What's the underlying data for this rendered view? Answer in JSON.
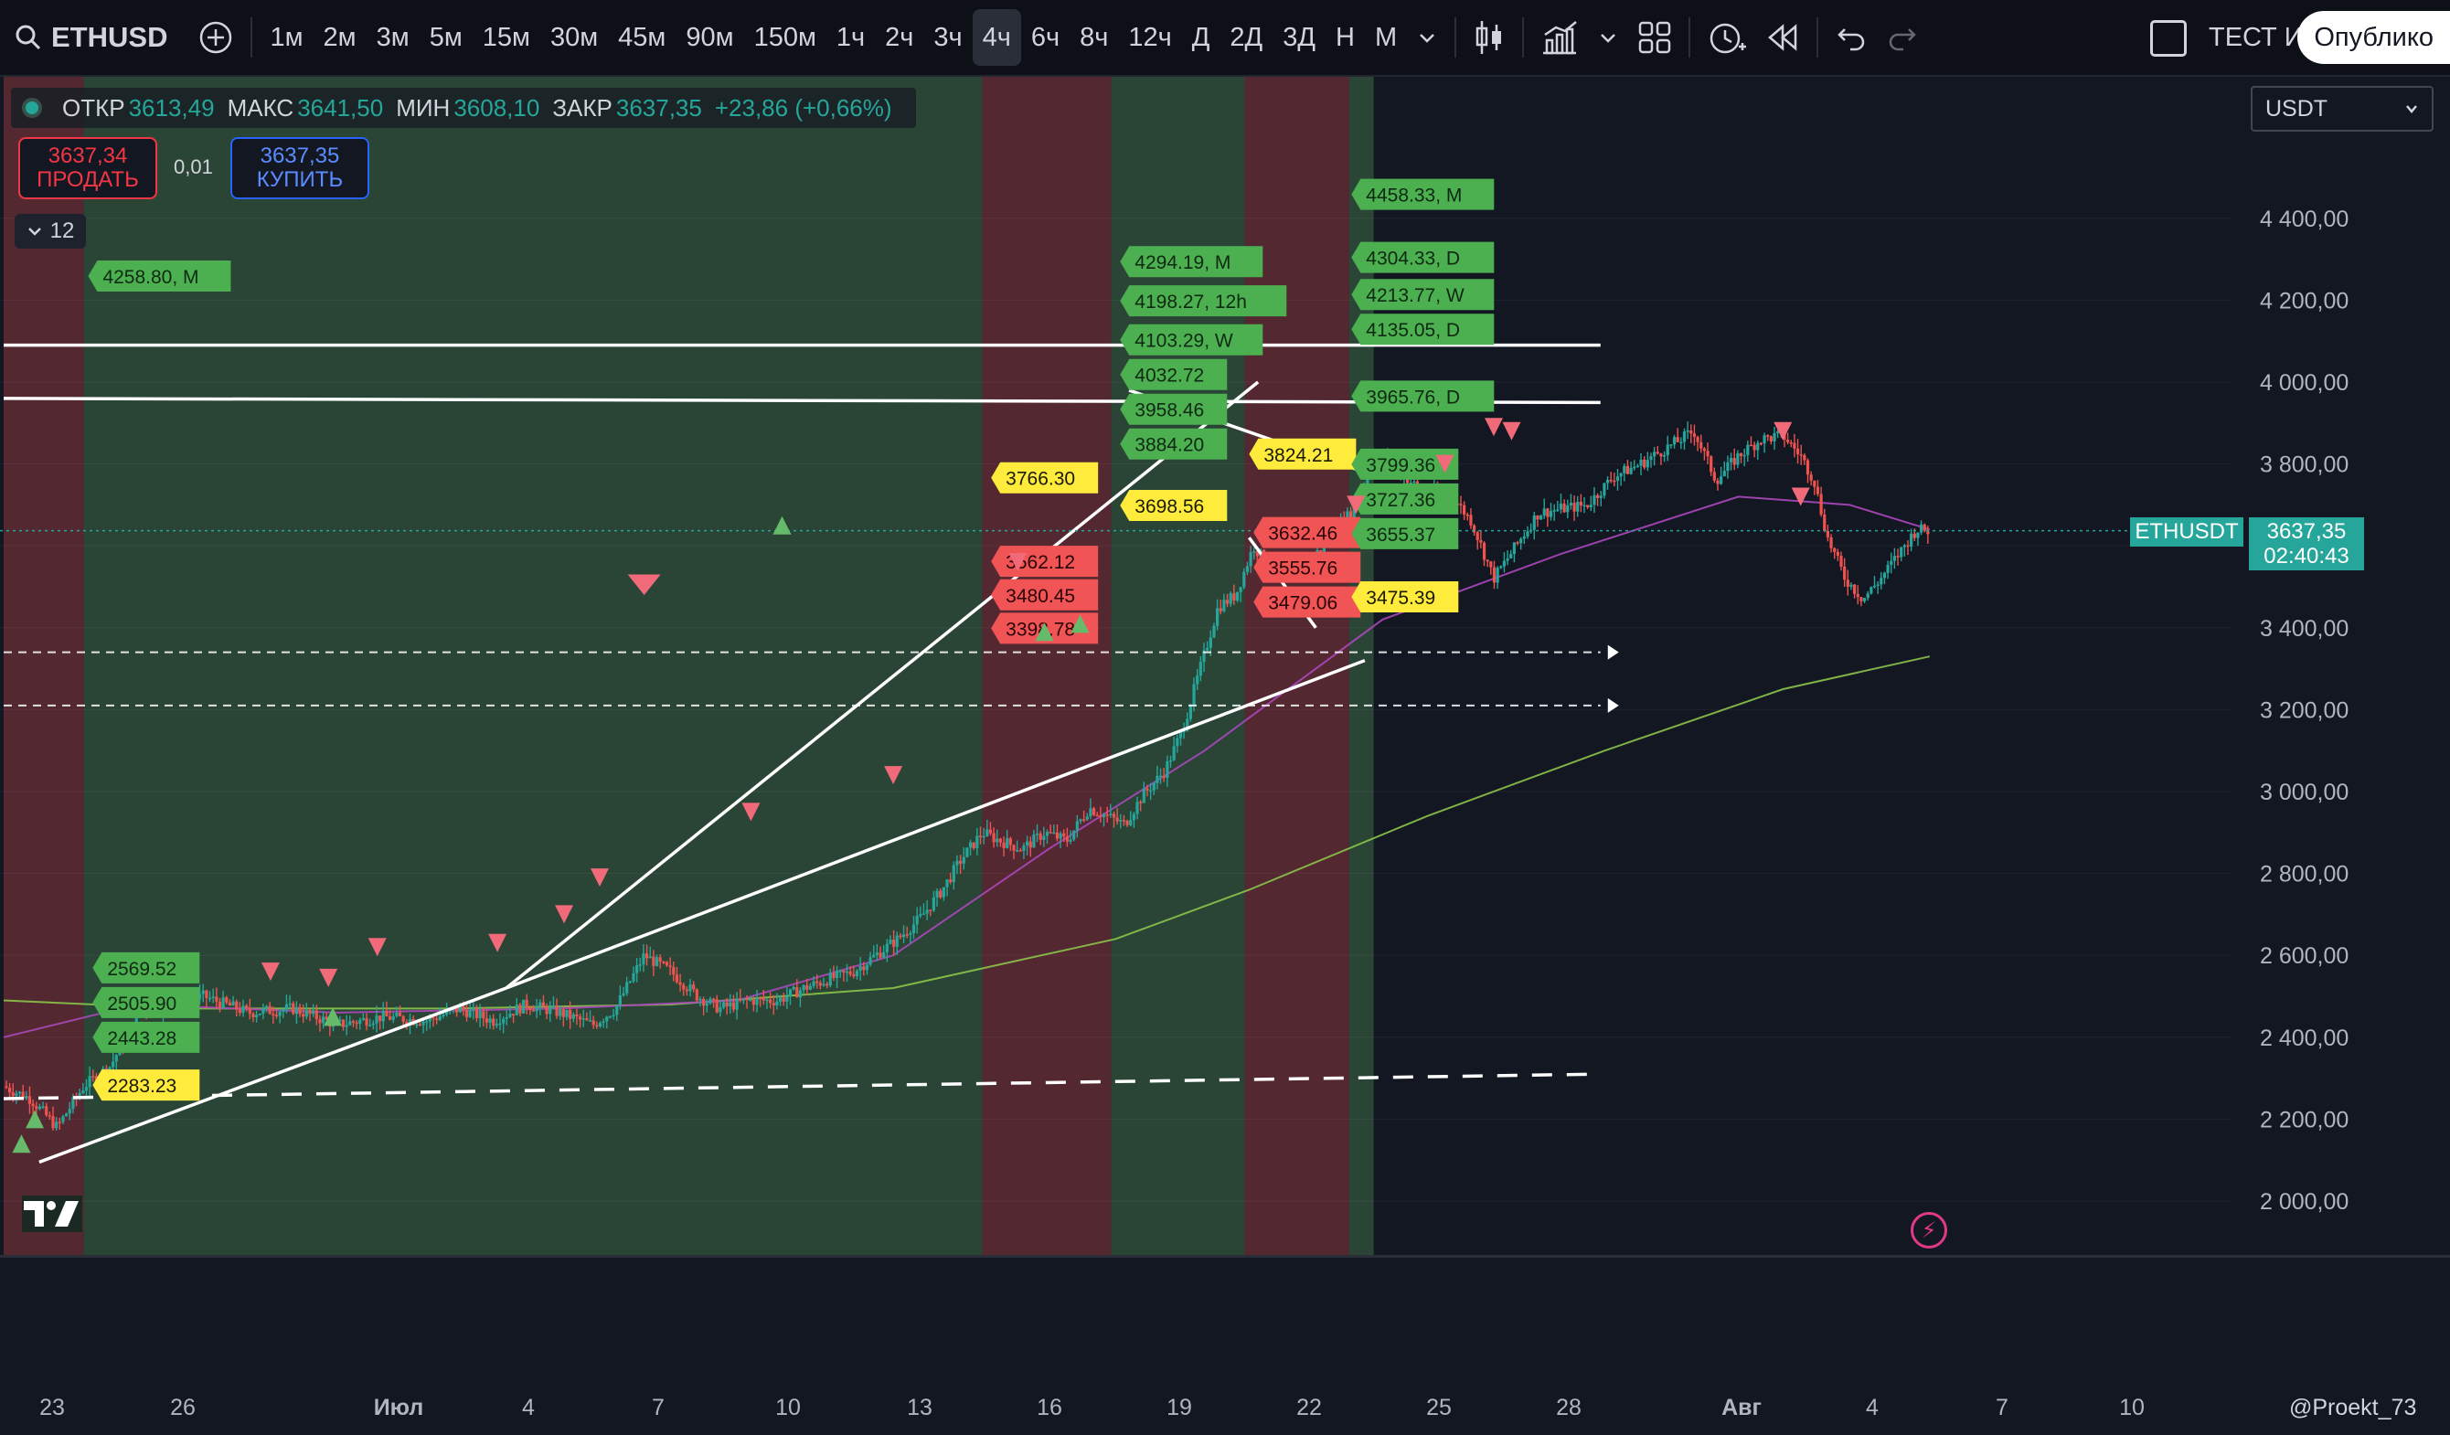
{
  "toolbar": {
    "symbol": "ETHUSD",
    "intervals": [
      "1м",
      "2м",
      "3м",
      "5м",
      "15м",
      "30м",
      "45м",
      "90м",
      "150м",
      "1ч",
      "2ч",
      "3ч",
      "4ч",
      "6ч",
      "8ч",
      "12ч",
      "Д",
      "2Д",
      "3Д",
      "Н",
      "М"
    ],
    "active_interval": "4ч",
    "test_label": "ТЕСТ И",
    "publish_label": "Опублико"
  },
  "legend": {
    "open_label": "ОТКР",
    "open": "3613,49",
    "high_label": "МАКС",
    "high": "3641,50",
    "low_label": "МИН",
    "low": "3608,10",
    "close_label": "ЗАКР",
    "close": "3637,35",
    "change": "+23,86 (+0,66%)"
  },
  "trade": {
    "sell_price": "3637,34",
    "sell_label": "ПРОДАТЬ",
    "spread": "0,01",
    "buy_price": "3637,35",
    "buy_label": "КУПИТЬ",
    "indicators_count": "12"
  },
  "currency": "USDT",
  "price_tag": {
    "name": "ETHUSDT",
    "price": "3637,35",
    "countdown": "02:40:43"
  },
  "watermark": "@Proekt_73",
  "colors": {
    "up": "#26a69a",
    "down": "#ef5350",
    "bg": "#131722"
  },
  "chart_data": {
    "type": "candlestick",
    "symbol": "ETHUSDT",
    "interval": "4h",
    "ylim": [
      1900,
      4600
    ],
    "y_ticks": [
      "2 000,00",
      "2 200,00",
      "2 400,00",
      "2 600,00",
      "2 800,00",
      "3 000,00",
      "3 200,00",
      "3 400,00",
      "3 600,00",
      "3 800,00",
      "4 000,00",
      "4 200,00",
      "4 400,00"
    ],
    "x_ticks": [
      "23",
      "26",
      "Июл",
      "4",
      "7",
      "10",
      "13",
      "16",
      "19",
      "22",
      "25",
      "28",
      "Авг",
      "4",
      "7",
      "10"
    ],
    "close_path": [
      [
        0,
        2280
      ],
      [
        12,
        2250
      ],
      [
        24,
        2180
      ],
      [
        36,
        2280
      ],
      [
        48,
        2330
      ],
      [
        62,
        2470
      ],
      [
        76,
        2480
      ],
      [
        90,
        2500
      ],
      [
        110,
        2460
      ],
      [
        130,
        2470
      ],
      [
        150,
        2430
      ],
      [
        170,
        2450
      ],
      [
        190,
        2440
      ],
      [
        205,
        2470
      ],
      [
        220,
        2440
      ],
      [
        235,
        2480
      ],
      [
        250,
        2460
      ],
      [
        265,
        2430
      ],
      [
        275,
        2470
      ],
      [
        288,
        2600
      ],
      [
        300,
        2560
      ],
      [
        312,
        2500
      ],
      [
        322,
        2470
      ],
      [
        335,
        2490
      ],
      [
        348,
        2490
      ],
      [
        360,
        2520
      ],
      [
        370,
        2540
      ],
      [
        382,
        2560
      ],
      [
        392,
        2600
      ],
      [
        402,
        2640
      ],
      [
        412,
        2690
      ],
      [
        422,
        2760
      ],
      [
        430,
        2830
      ],
      [
        440,
        2900
      ],
      [
        448,
        2880
      ],
      [
        458,
        2860
      ],
      [
        468,
        2900
      ],
      [
        478,
        2880
      ],
      [
        488,
        2960
      ],
      [
        496,
        2940
      ],
      [
        504,
        2920
      ],
      [
        512,
        2990
      ],
      [
        522,
        3050
      ],
      [
        530,
        3150
      ],
      [
        538,
        3300
      ],
      [
        546,
        3450
      ],
      [
        554,
        3480
      ],
      [
        562,
        3600
      ],
      [
        570,
        3540
      ],
      [
        580,
        3530
      ],
      [
        590,
        3580
      ],
      [
        600,
        3640
      ],
      [
        608,
        3700
      ],
      [
        616,
        3820
      ],
      [
        624,
        3800
      ],
      [
        632,
        3760
      ],
      [
        640,
        3720
      ],
      [
        650,
        3730
      ],
      [
        660,
        3660
      ],
      [
        670,
        3520
      ],
      [
        680,
        3600
      ],
      [
        690,
        3680
      ],
      [
        700,
        3690
      ],
      [
        712,
        3700
      ],
      [
        724,
        3770
      ],
      [
        736,
        3800
      ],
      [
        748,
        3840
      ],
      [
        760,
        3880
      ],
      [
        770,
        3760
      ],
      [
        780,
        3820
      ],
      [
        790,
        3860
      ],
      [
        800,
        3870
      ],
      [
        808,
        3820
      ],
      [
        814,
        3760
      ],
      [
        820,
        3620
      ],
      [
        828,
        3520
      ],
      [
        836,
        3470
      ],
      [
        844,
        3520
      ],
      [
        852,
        3580
      ],
      [
        860,
        3640
      ],
      [
        866,
        3637
      ]
    ],
    "moving_averages": [
      {
        "name": "MA slow",
        "color": "#8bc34a",
        "points": [
          [
            0,
            2490
          ],
          [
            80,
            2470
          ],
          [
            200,
            2470
          ],
          [
            300,
            2480
          ],
          [
            400,
            2520
          ],
          [
            500,
            2640
          ],
          [
            560,
            2760
          ],
          [
            640,
            2940
          ],
          [
            720,
            3100
          ],
          [
            800,
            3250
          ],
          [
            866,
            3330
          ]
        ]
      },
      {
        "name": "MA fast",
        "color": "#ab47bc",
        "points": [
          [
            0,
            2400
          ],
          [
            60,
            2480
          ],
          [
            150,
            2460
          ],
          [
            250,
            2470
          ],
          [
            330,
            2490
          ],
          [
            400,
            2600
          ],
          [
            470,
            2860
          ],
          [
            540,
            3100
          ],
          [
            620,
            3420
          ],
          [
            700,
            3580
          ],
          [
            780,
            3720
          ],
          [
            830,
            3700
          ],
          [
            866,
            3640
          ]
        ]
      }
    ],
    "regime_bands": [
      {
        "from": 0,
        "to": 36,
        "regime": "bear"
      },
      {
        "from": 36,
        "to": 440,
        "regime": "bull"
      },
      {
        "from": 440,
        "to": 498,
        "regime": "bear"
      },
      {
        "from": 498,
        "to": 558,
        "regime": "bull"
      },
      {
        "from": 558,
        "to": 605,
        "regime": "bear"
      },
      {
        "from": 605,
        "to": 616,
        "regime": "bull"
      }
    ],
    "trendlines": [
      {
        "from": [
          16,
          2095
        ],
        "to": [
          226,
          2520
        ],
        "style": "solid"
      },
      {
        "from": [
          226,
          2520
        ],
        "to": [
          564,
          4000
        ],
        "style": "solid"
      },
      {
        "from": [
          0,
          3960
        ],
        "to": [
          718,
          3950
        ],
        "style": "solid"
      },
      {
        "from": [
          0,
          4090
        ],
        "to": [
          718,
          4090
        ],
        "style": "solid"
      },
      {
        "from": [
          226,
          2520
        ],
        "to": [
          612,
          3320
        ],
        "style": "solid"
      },
      {
        "from": [
          506,
          3980
        ],
        "to": [
          612,
          3780
        ],
        "style": "solid"
      },
      {
        "from": [
          560,
          3620
        ],
        "to": [
          590,
          3400
        ],
        "style": "solid"
      },
      {
        "from": [
          0,
          2250
        ],
        "to": [
          718,
          2310
        ],
        "style": "dashed"
      },
      {
        "from": [
          0,
          3340
        ],
        "to": [
          718,
          3340
        ],
        "style": "dashed-thin"
      },
      {
        "from": [
          0,
          3210
        ],
        "to": [
          718,
          3210
        ],
        "style": "dashed-thin"
      }
    ],
    "level_labels": [
      {
        "text": "4258.80, M",
        "x": 38,
        "y": 4258.8,
        "color": "green"
      },
      {
        "text": "2569.52",
        "x": 40,
        "y": 2569.52,
        "color": "green"
      },
      {
        "text": "2505.90",
        "x": 40,
        "y": 2505.9,
        "color": "green"
      },
      {
        "text": "2443.28",
        "x": 40,
        "y": 2443.28,
        "color": "green"
      },
      {
        "text": "2283.23",
        "x": 40,
        "y": 2283.23,
        "color": "yellow"
      },
      {
        "text": "4294.19, M",
        "x": 502,
        "y": 4294.19,
        "color": "green"
      },
      {
        "text": "4198.27, 12h",
        "x": 502,
        "y": 4198.27,
        "color": "green"
      },
      {
        "text": "4103.29, W",
        "x": 502,
        "y": 4103.29,
        "color": "green"
      },
      {
        "text": "4032.72",
        "x": 502,
        "y": 4032.72,
        "color": "green"
      },
      {
        "text": "3958.46",
        "x": 502,
        "y": 3958.46,
        "color": "green"
      },
      {
        "text": "3884.20",
        "x": 502,
        "y": 3884.2,
        "color": "green"
      },
      {
        "text": "3698.56",
        "x": 502,
        "y": 3698.56,
        "color": "yellow"
      },
      {
        "text": "3766.30",
        "x": 444,
        "y": 3766.3,
        "color": "yellow"
      },
      {
        "text": "3562.12",
        "x": 444,
        "y": 3562.12,
        "color": "red"
      },
      {
        "text": "3480.45",
        "x": 444,
        "y": 3480.45,
        "color": "red"
      },
      {
        "text": "3398.78",
        "x": 444,
        "y": 3398.78,
        "color": "red"
      },
      {
        "text": "3824.21",
        "x": 560,
        "y": 3824.21,
        "color": "yellow"
      },
      {
        "text": "3632.46",
        "x": 562,
        "y": 3632.46,
        "color": "red"
      },
      {
        "text": "3555.76",
        "x": 562,
        "y": 3555.76,
        "color": "red"
      },
      {
        "text": "3479.06",
        "x": 562,
        "y": 3479.06,
        "color": "red"
      },
      {
        "text": "4458.33, M",
        "x": 606,
        "y": 4458.33,
        "color": "green"
      },
      {
        "text": "4304.33, D",
        "x": 606,
        "y": 4304.33,
        "color": "green"
      },
      {
        "text": "4213.77, W",
        "x": 606,
        "y": 4213.77,
        "color": "green"
      },
      {
        "text": "4135.05, D",
        "x": 606,
        "y": 4135.05,
        "color": "green"
      },
      {
        "text": "3965.76, D",
        "x": 606,
        "y": 3965.76,
        "color": "green"
      },
      {
        "text": "3799.36",
        "x": 606,
        "y": 3799.36,
        "color": "green"
      },
      {
        "text": "3727.36",
        "x": 606,
        "y": 3727.36,
        "color": "green"
      },
      {
        "text": "3655.37",
        "x": 606,
        "y": 3655.37,
        "color": "green"
      },
      {
        "text": "3475.39",
        "x": 606,
        "y": 3475.39,
        "color": "yellow"
      }
    ]
  }
}
